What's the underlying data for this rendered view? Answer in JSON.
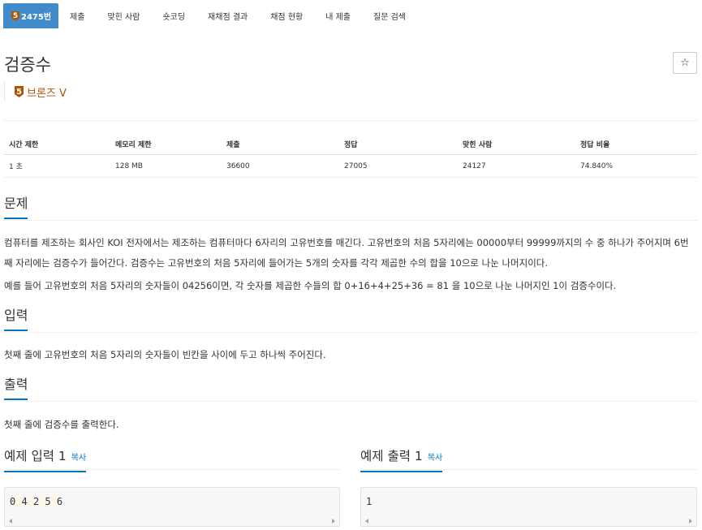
{
  "nav": {
    "problem_tier_number": "5",
    "problem_number": "2475번",
    "items": [
      "제출",
      "맞힌 사람",
      "숏코딩",
      "재채점 결과",
      "채점 현황",
      "내 제출",
      "질문 검색"
    ]
  },
  "problem": {
    "title": "검증수",
    "star": "☆",
    "tier_number": "5",
    "tier_name": "브론즈 V",
    "tier_color": "#ad5600"
  },
  "info_table": {
    "headers": [
      "시간 제한",
      "메모리 제한",
      "제출",
      "정답",
      "맞힌 사람",
      "정답 비율"
    ],
    "values": [
      "1 초",
      "128 MB",
      "36600",
      "27005",
      "24127",
      "74.840%"
    ]
  },
  "sections": {
    "description_title": "문제",
    "description_p1": "컴퓨터를 제조하는 회사인 KOI 전자에서는 제조하는 컴퓨터마다 6자리의 고유번호를 매긴다. 고유번호의 처음 5자리에는 00000부터 99999까지의 수 중 하나가 주어지며 6번째 자리에는 검증수가 들어간다. 검증수는 고유번호의 처음 5자리에 들어가는 5개의 숫자를 각각 제곱한 수의 합을 10으로 나눈 나머지이다.",
    "description_p2": "예를 들어 고유번호의 처음 5자리의 숫자들이 04256이면, 각 숫자를 제곱한 수들의 합 0+16+4+25+36 = 81 을 10으로 나눈 나머지인 1이 검증수이다.",
    "input_title": "입력",
    "input_text": "첫째 줄에 고유번호의 처음 5자리의 숫자들이 빈칸을 사이에 두고 하나씩 주어진다.",
    "output_title": "출력",
    "output_text": "첫째 줄에 검증수를 출력한다."
  },
  "samples": {
    "input_title": "예제 입력 1",
    "output_title": "예제 출력 1",
    "copy_label": "복사",
    "input_tokens": [
      "0",
      "4",
      "2",
      "5",
      "6"
    ],
    "output_value": "1"
  },
  "colors": {
    "accent": "#428bca",
    "link": "#0076c0"
  }
}
